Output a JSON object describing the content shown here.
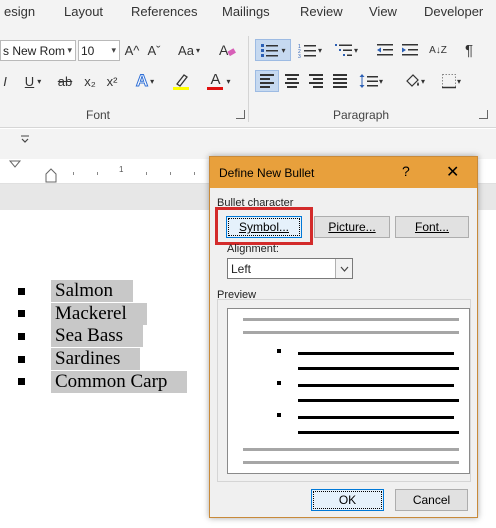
{
  "ribbon": {
    "tabs": [
      "esign",
      "Layout",
      "References",
      "Mailings",
      "Review",
      "View",
      "Developer"
    ],
    "font_name": "s New Rom",
    "font_size": "10",
    "grow_font": "A^",
    "shrink_font": "Aˇ",
    "change_case": "Aa",
    "underline": "U",
    "strikethrough": "ab",
    "subscript": "x₂",
    "superscript": "x²",
    "italic_partial": "I",
    "text_effects": "A",
    "font_color": "A",
    "sort": "A↓Z",
    "pilcrow": "¶",
    "font_group_label": "Font",
    "paragraph_group_label": "Paragraph",
    "qat_icon": "chevron-down-icon",
    "ruler_number": "1",
    "colors": {
      "highlight": "#ffff00",
      "font_color": "#e01010",
      "selected_button": "#c6d9f0"
    }
  },
  "document": {
    "list_items": [
      "Salmon",
      "Mackerel",
      "Sea Bass",
      "Sardines",
      "Common Carp"
    ]
  },
  "dialog": {
    "title": "Define New Bullet",
    "help": "?",
    "close": "✕",
    "bullet_character_label": "Bullet character",
    "symbol_button": "Symbol...",
    "picture_button": "Picture...",
    "font_button": "Font...",
    "alignment_label": "Alignment:",
    "alignment_value": "Left",
    "preview_label": "Preview",
    "ok_button": "OK",
    "cancel_button": "Cancel",
    "colors": {
      "title_bar": "#e8a03c",
      "highlight_frame": "#d32b2b"
    }
  }
}
